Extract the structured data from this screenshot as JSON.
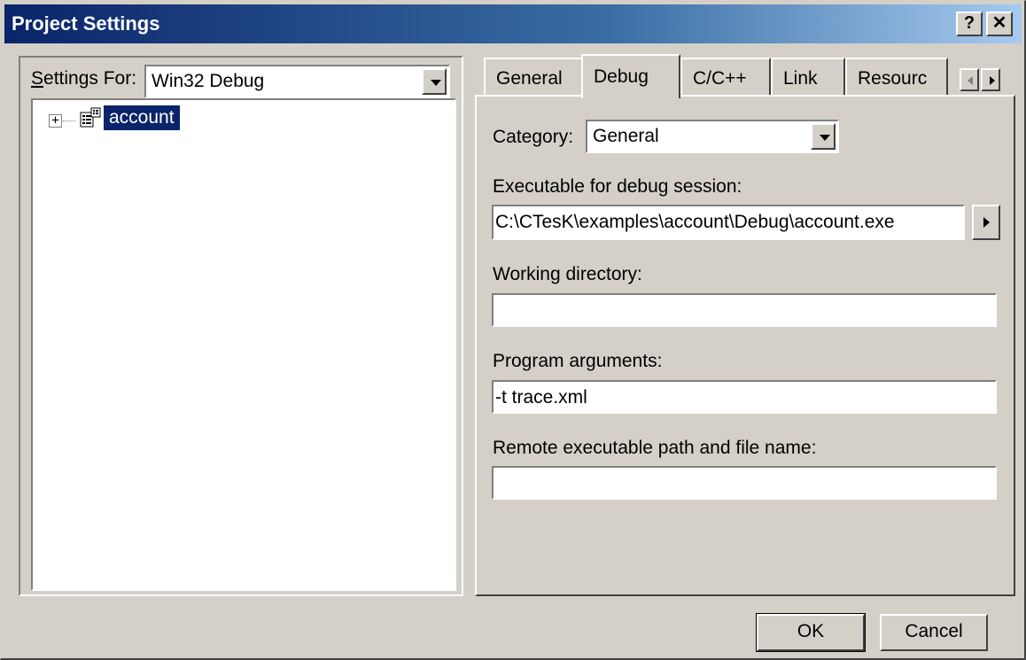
{
  "window": {
    "title": "Project Settings",
    "help_label": "?",
    "close_label": "✕"
  },
  "settings_for": {
    "label": "Settings For:",
    "value": "Win32 Debug"
  },
  "tree": {
    "expander": "+",
    "item_label": "account"
  },
  "tabs": [
    {
      "label": "General",
      "active": false
    },
    {
      "label": "Debug",
      "active": true
    },
    {
      "label": "C/C++",
      "active": false
    },
    {
      "label": "Link",
      "active": false
    },
    {
      "label": "Resourc",
      "active": false
    }
  ],
  "debug_tab": {
    "category_label": "Category:",
    "category_value": "General",
    "executable_label": "Executable for debug session:",
    "executable_value": "C:\\CTesK\\examples\\account\\Debug\\account.exe",
    "working_dir_label": "Working directory:",
    "working_dir_value": "",
    "program_args_label": "Program arguments:",
    "program_args_value": "-t trace.xml",
    "remote_path_label": "Remote executable path and file name:",
    "remote_path_value": ""
  },
  "buttons": {
    "ok": "OK",
    "cancel": "Cancel"
  }
}
